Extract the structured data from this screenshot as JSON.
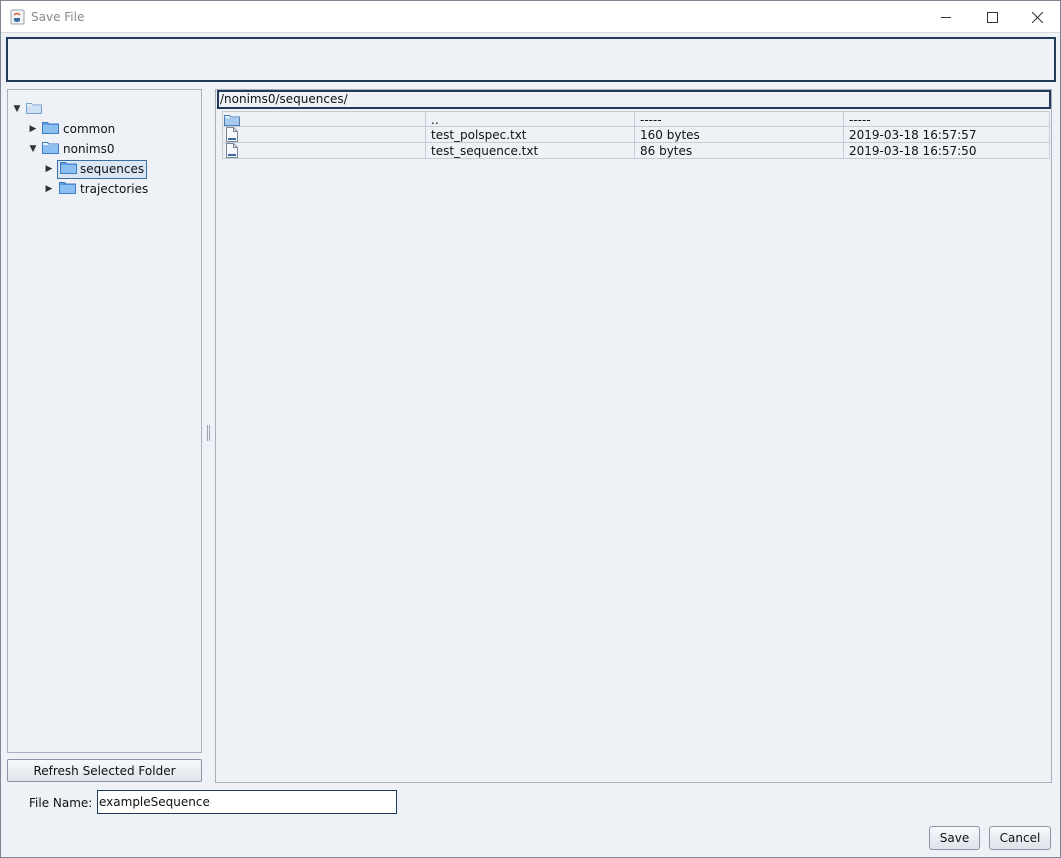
{
  "window": {
    "title": "Save File",
    "app_icon": "java-coffee-icon",
    "controls": [
      "minimize-icon",
      "maximize-icon",
      "close-icon"
    ]
  },
  "tree": {
    "root": {
      "icon": "folder-icon",
      "expanded": true
    },
    "items": [
      {
        "label": "common",
        "level": 1,
        "expanded": false,
        "selected": false
      },
      {
        "label": "nonims0",
        "level": 1,
        "expanded": true,
        "selected": false
      },
      {
        "label": "sequences",
        "level": 2,
        "expanded": false,
        "selected": true
      },
      {
        "label": "trajectories",
        "level": 2,
        "expanded": false,
        "selected": false
      }
    ],
    "refresh_label": "Refresh Selected Folder"
  },
  "files": {
    "path": "/nonims0/sequences/",
    "rows": [
      {
        "icon": "folder-icon",
        "name": "..",
        "size": "-----",
        "date": "-----"
      },
      {
        "icon": "file-icon",
        "name": "test_polspec.txt",
        "size": "160 bytes",
        "date": "2019-03-18 16:57:57"
      },
      {
        "icon": "file-icon",
        "name": "test_sequence.txt",
        "size": "86 bytes",
        "date": "2019-03-18 16:57:50"
      }
    ]
  },
  "bottom": {
    "file_name_label": "File Name:",
    "file_name_value": "exampleSequence",
    "save_label": "Save",
    "cancel_label": "Cancel"
  },
  "colors": {
    "background": "#eef2f7",
    "focus_border": "#1f3a5a",
    "folder_blue": "#6fa8e8"
  }
}
